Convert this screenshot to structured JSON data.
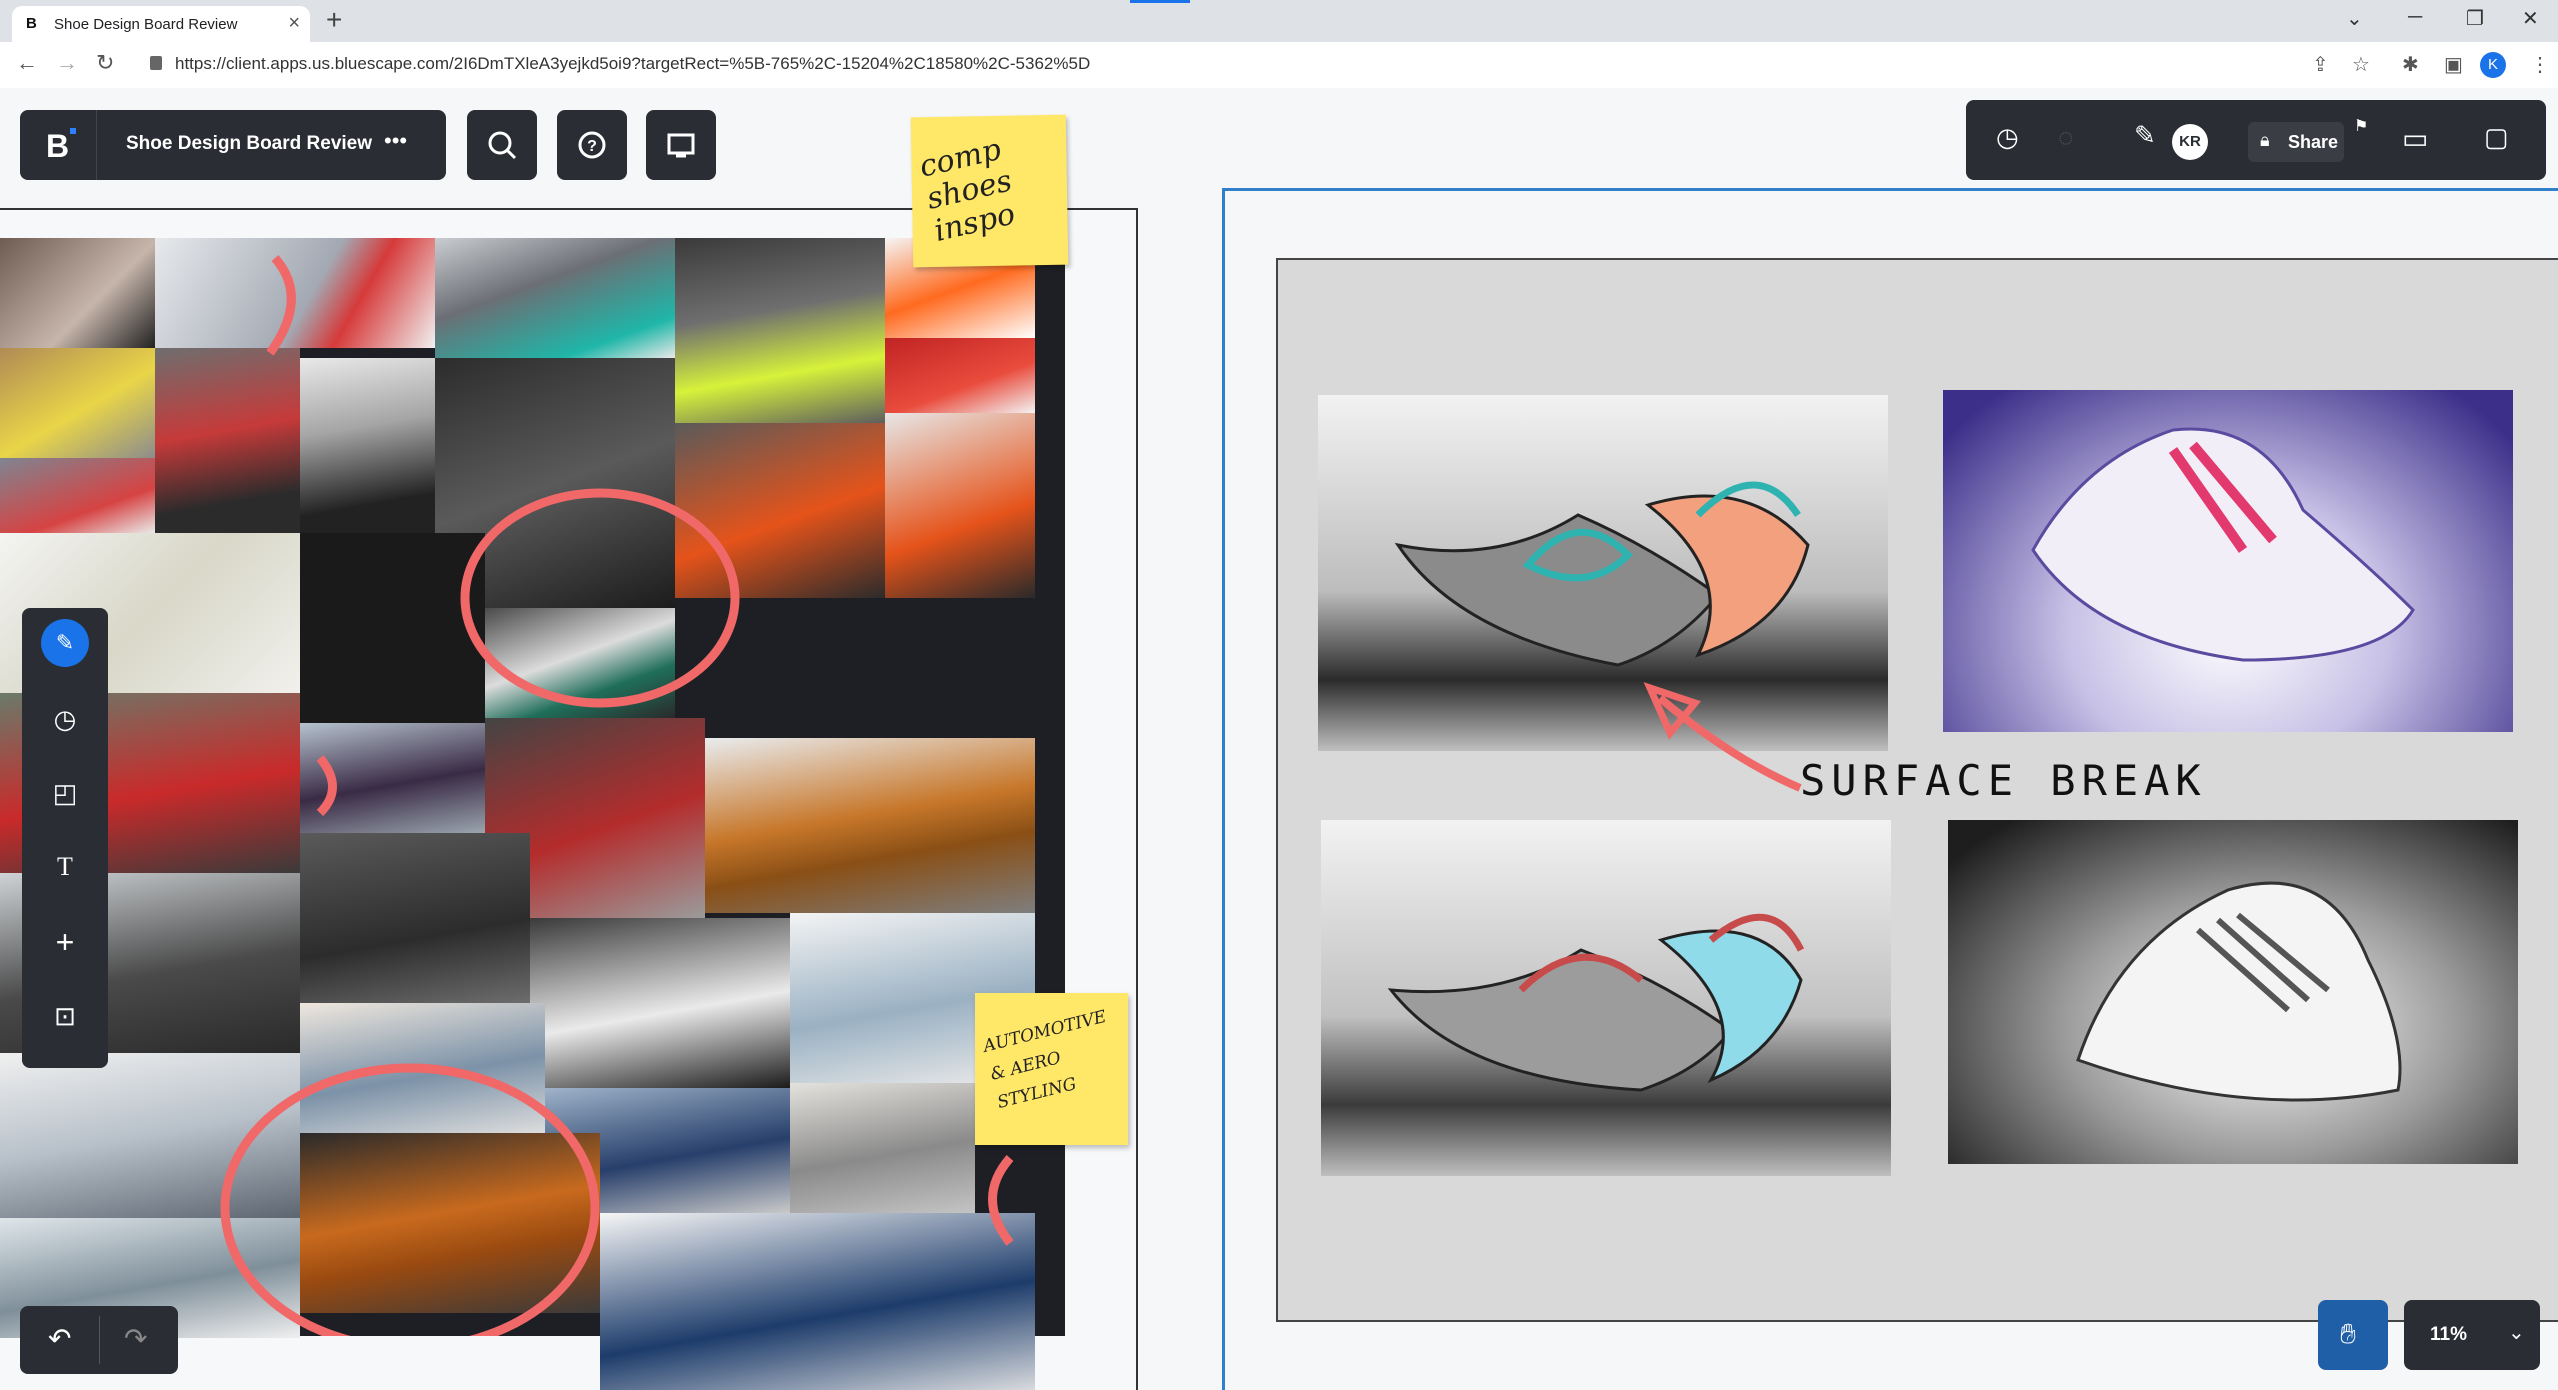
{
  "browser": {
    "tab_title": "Shoe Design Board Review",
    "tab_favicon": "B",
    "url": "https://client.apps.us.bluescape.com/2I6DmTXleA3yejkd5oi9?targetRect=%5B-765%2C-15204%2C18580%2C-5362%5D",
    "profile_initial": "K"
  },
  "app": {
    "logo": "B",
    "workspace_title": "Shoe Design Board Review",
    "more_label": "•••",
    "user_initials": "KR",
    "share_label": "Share",
    "zoom_label": "11%"
  },
  "notes": {
    "inspo": "comp shoes inspo",
    "automotive": "AUTOMOTIVE & AERO STYLING"
  },
  "annotation": "SURFACE BREAK",
  "colors": {
    "toolbar": "#2a2d33",
    "accent": "#1a73e8",
    "sticky": "#ffe768",
    "frame": "#2f80c8",
    "ink": "#f06868"
  },
  "icons": {
    "search": "search-icon",
    "help": "help-icon",
    "cast": "screen-share-icon",
    "pen": "pen-icon",
    "shapes": "shapes-icon",
    "note": "sticky-note-icon",
    "text": "text-icon",
    "add": "plus-icon",
    "frame": "frame-icon",
    "undo": "undo-icon",
    "redo": "redo-icon",
    "hand": "hand-icon",
    "video": "video-icon",
    "chat": "chat-icon"
  }
}
